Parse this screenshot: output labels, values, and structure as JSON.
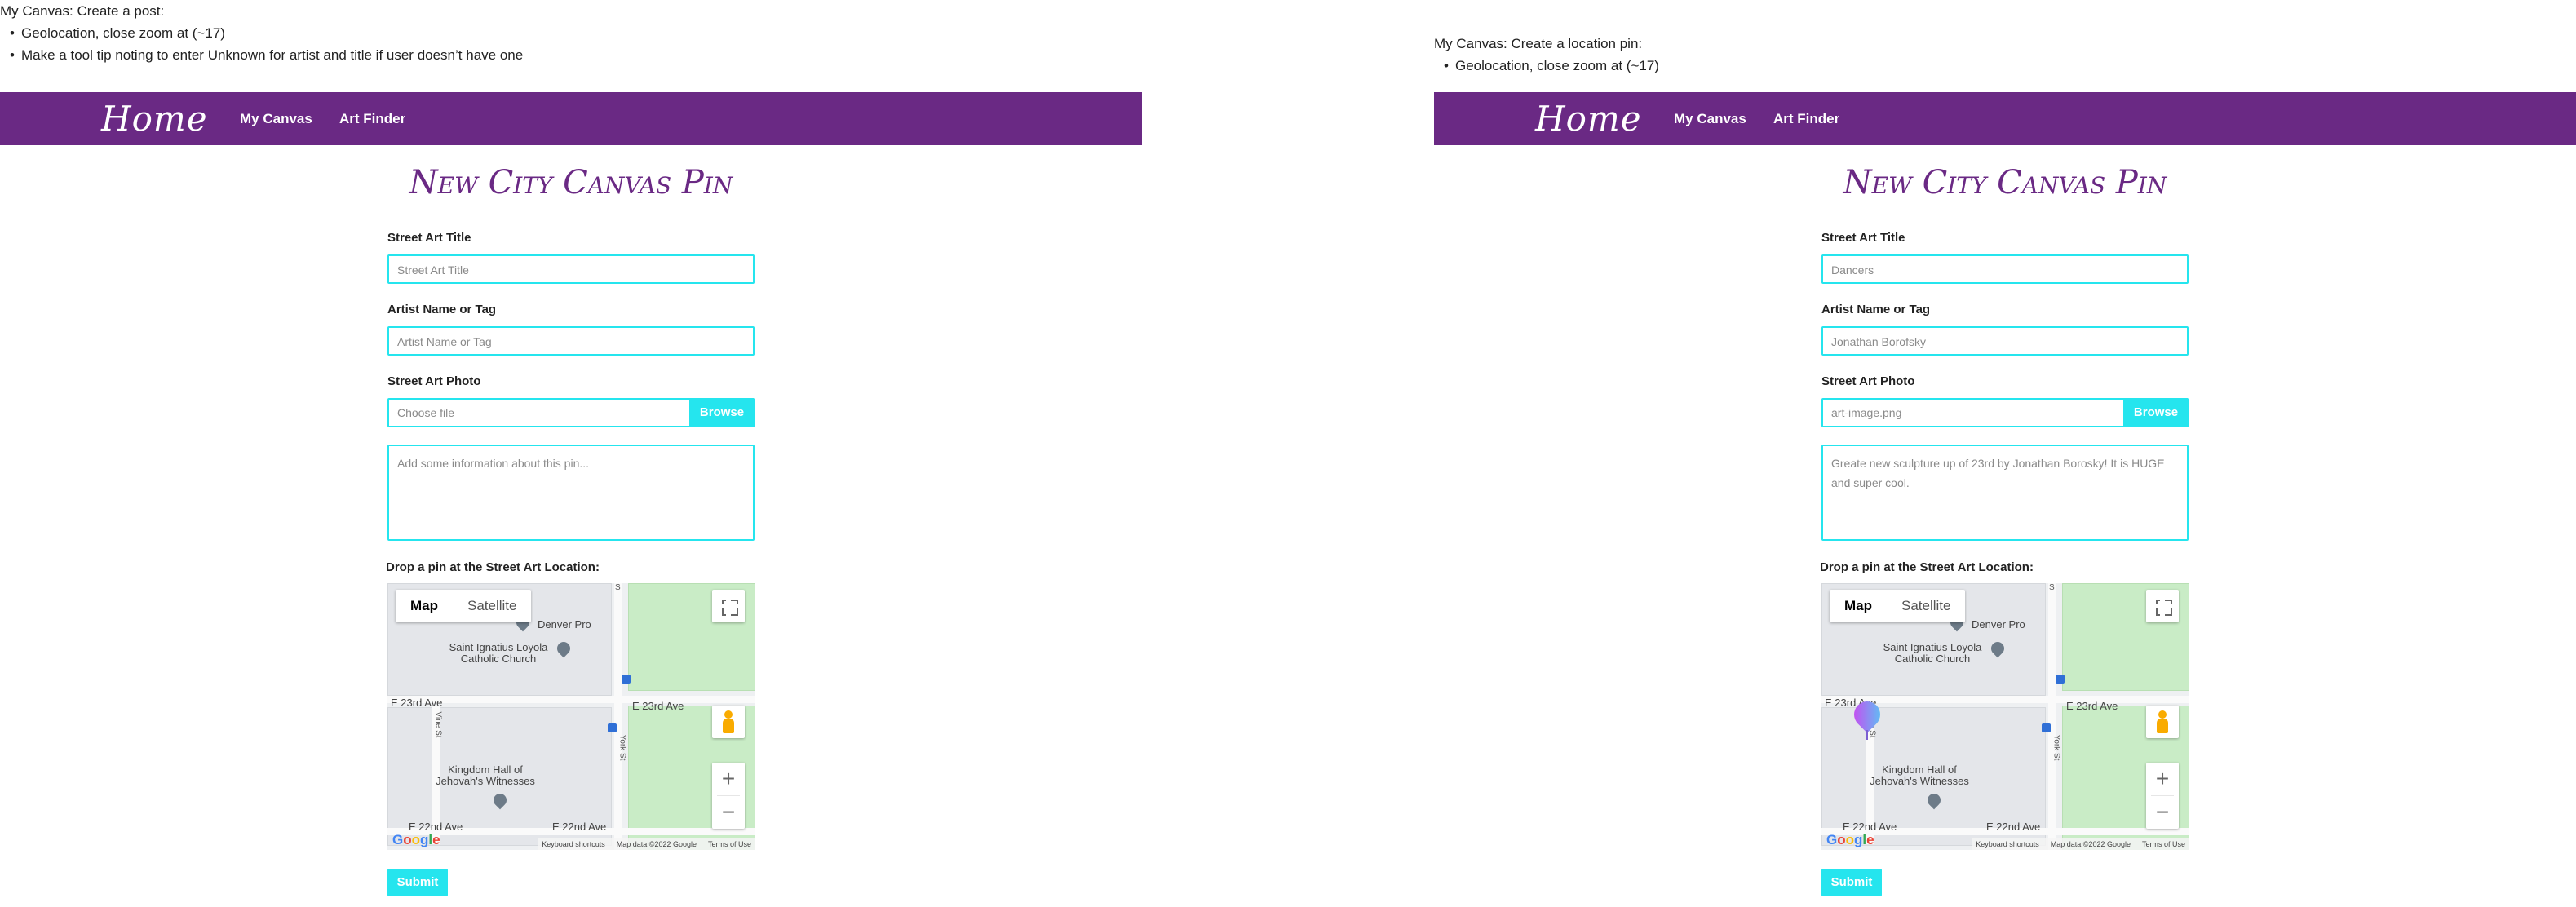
{
  "notes": {
    "left": {
      "title": "My Canvas: Create a post:",
      "bullets": [
        "Geolocation, close zoom at (~17)",
        "Make a tool tip noting to enter Unknown for artist and title if user doesn’t have one"
      ]
    },
    "right": {
      "title": "My Canvas: Create a location pin:",
      "bullets": [
        "Geolocation, close zoom at (~17)"
      ]
    }
  },
  "nav": {
    "brand": "Home",
    "links": [
      "My Canvas",
      "Art Finder"
    ]
  },
  "colors": {
    "nav_bg": "#6a2984",
    "accent": "#25e5ee",
    "title": "#6a2984"
  },
  "map": {
    "type_buttons": [
      "Map",
      "Satellite"
    ],
    "labels": {
      "denver_pro": "Denver Pro",
      "church": "Saint Ignatius Loyola Catholic Church",
      "e23_left": "E 23rd Ave",
      "e23_right": "E 23rd Ave",
      "kingdom_hall": "Kingdom Hall of Jehovah's Witnesses",
      "e22_left": "E 22nd Ave",
      "e22_right": "E 22nd Ave",
      "york": "York St",
      "vine": "Vine St",
      "s": "S"
    },
    "attribution": [
      "Keyboard shortcuts",
      "Map data ©2022 Google",
      "Terms of Use"
    ],
    "zoom_in": "+",
    "zoom_out": "−",
    "google": [
      "G",
      "o",
      "o",
      "g",
      "l",
      "e"
    ],
    "icons": [
      "fullscreen-icon",
      "pegman-icon",
      "zoom-in-icon",
      "zoom-out-icon"
    ]
  },
  "panels": [
    {
      "form_title": "New City Canvas Pin",
      "title_label": "Street Art Title",
      "title_value": "Street Art Title",
      "artist_label": "Artist Name or Tag",
      "artist_value": "Artist Name or Tag",
      "photo_label": "Street Art Photo",
      "photo_value": "Choose file",
      "browse": "Browse",
      "description": "Add some information about this pin...",
      "drop_label": "Drop a pin at the Street Art Location:",
      "submit": "Submit"
    },
    {
      "form_title": "New City Canvas Pin",
      "title_label": "Street Art Title",
      "title_value": "Dancers",
      "artist_label": "Artist Name or Tag",
      "artist_value": "Jonathan Borofsky",
      "photo_label": "Street Art Photo",
      "photo_value": "art-image.png",
      "browse": "Browse",
      "description": "Greate new sculpture up of 23rd by Jonathan Borosky! It is HUGE and super cool.",
      "drop_label": "Drop a pin at the Street Art Location:",
      "submit": "Submit"
    }
  ]
}
